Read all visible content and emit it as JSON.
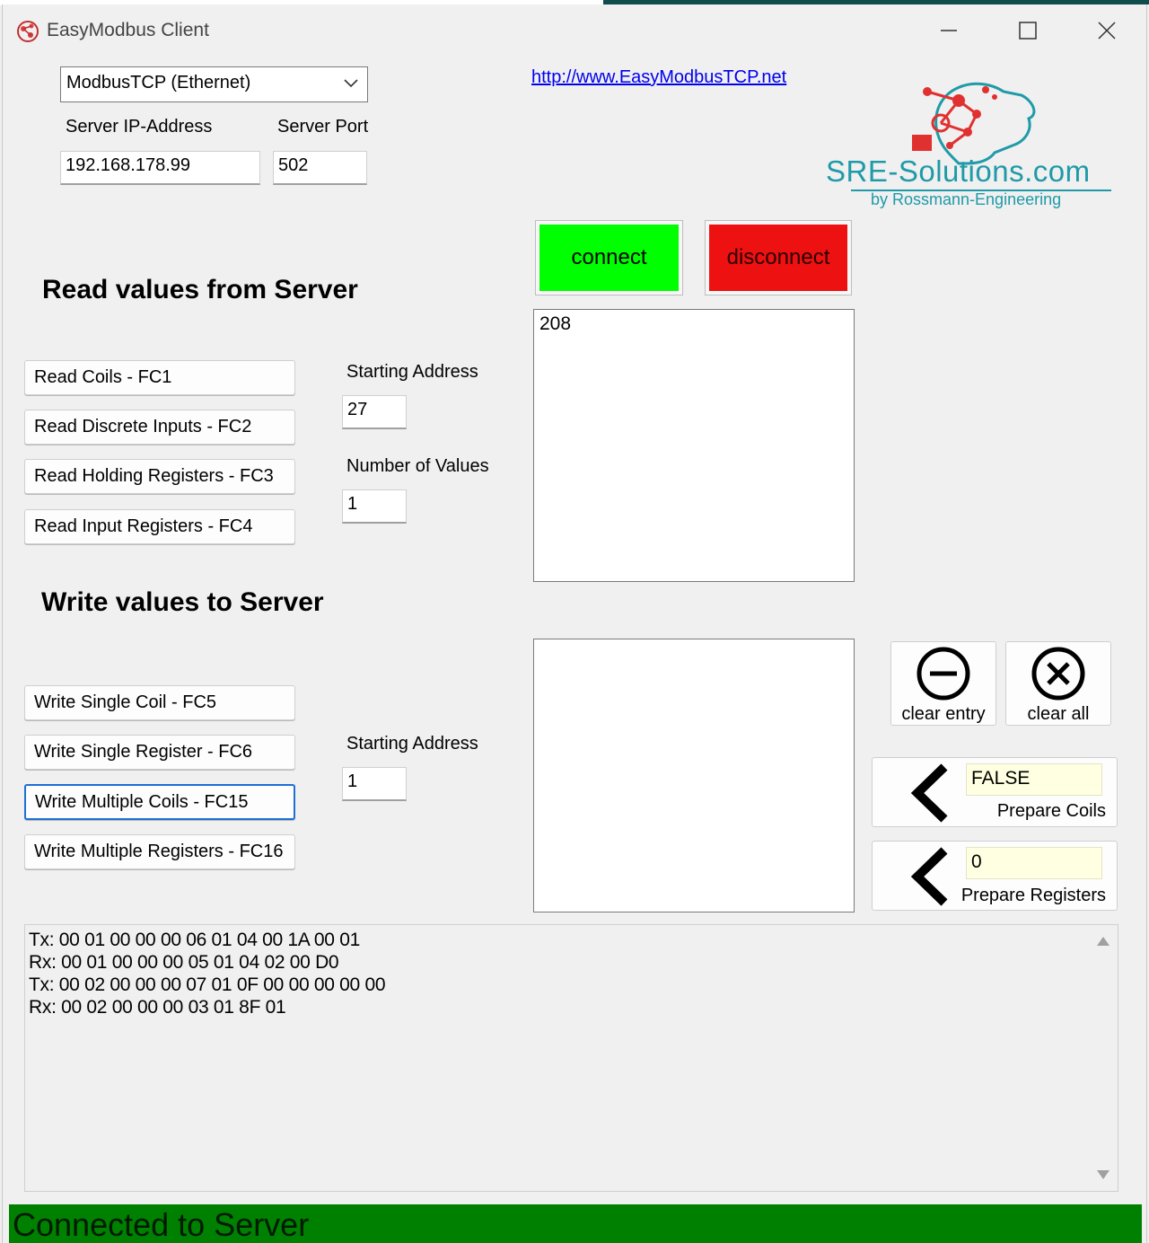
{
  "window": {
    "title": "EasyModbus Client"
  },
  "connection": {
    "mode_selected": "ModbusTCP (Ethernet)",
    "ip_label": "Server IP-Address",
    "ip_value": "192.168.178.99",
    "port_label": "Server Port",
    "port_value": "502",
    "link_text": "http://www.EasyModbusTCP.net",
    "connect_label": "connect",
    "disconnect_label": "disconnect"
  },
  "logo": {
    "name": "SRE-Solutions.com",
    "sub": "by Rossmann-Engineering"
  },
  "read": {
    "heading": "Read values from Server",
    "buttons": [
      "Read Coils - FC1",
      "Read Discrete Inputs - FC2",
      "Read Holding Registers - FC3",
      "Read Input Registers - FC4"
    ],
    "start_label": "Starting Address",
    "start_value": "27",
    "count_label": "Number of Values",
    "count_value": "1",
    "results": [
      "208"
    ]
  },
  "write": {
    "heading": "Write values to Server",
    "buttons": [
      "Write Single Coil - FC5",
      "Write Single Register - FC6",
      "Write Multiple Coils - FC15",
      "Write Multiple Registers - FC16"
    ],
    "start_label": "Starting Address",
    "start_value": "1",
    "clear_entry_label": "clear entry",
    "clear_all_label": "clear all",
    "coil_value": "FALSE",
    "prepare_coils_label": "Prepare Coils",
    "register_value": "0",
    "prepare_registers_label": "Prepare Registers"
  },
  "log": {
    "lines": [
      "Tx: 00 01 00 00 00 06 01 04 00 1A 00 01",
      "Rx: 00 01 00 00 00 05 01 04 02 00 D0",
      "Tx: 00 02 00 00 00 07 01 0F 00 00 00 00 00",
      "Rx: 00 02 00 00 00 03 01 8F 01"
    ]
  },
  "status": {
    "text": "Connected to Server"
  },
  "colors": {
    "connect": "#00ff00",
    "disconnect": "#ee1111",
    "status": "#008000",
    "logo_teal": "#1f9aa8",
    "logo_red": "#e03030"
  }
}
